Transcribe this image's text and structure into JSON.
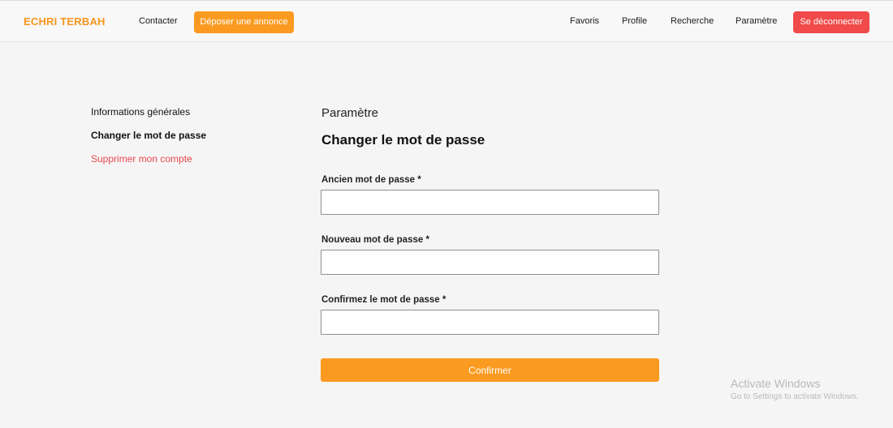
{
  "navbar": {
    "brand": "ECHRI TERBAH",
    "contact_label": "Contacter",
    "post_ad_label": "Déposer une annonce",
    "favorites_label": "Favoris",
    "profile_label": "Profile",
    "search_label": "Recherche",
    "settings_label": "Paramètre",
    "logout_label": "Se déconnecter"
  },
  "sidebar": {
    "items": [
      {
        "label": "Informations générales"
      },
      {
        "label": "Changer le mot de passe"
      },
      {
        "label": "Supprimer mon compte"
      }
    ]
  },
  "main": {
    "section_label": "Paramètre",
    "title": "Changer le mot de passe",
    "fields": [
      {
        "label": "Ancien mot de passe *",
        "value": ""
      },
      {
        "label": "Nouveau mot de passe *",
        "value": ""
      },
      {
        "label": "Confirmez le mot de passe *",
        "value": ""
      }
    ],
    "submit_label": "Confirmer"
  },
  "watermark": {
    "title": "Activate Windows",
    "subtitle": "Go to Settings to activate Windows."
  },
  "colors": {
    "brand": "#f7941d",
    "primary_button": "#fb9a21",
    "danger": "#f04a4a"
  }
}
